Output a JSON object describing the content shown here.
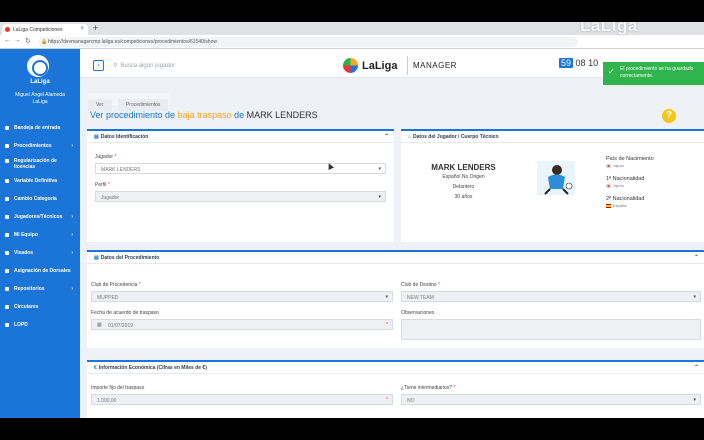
{
  "browser": {
    "tab_title": "LaLiga Competiciones",
    "url": "https://devmanagercmp.laliga.es/competiciones/procedimientos/61540/show",
    "watermark": "LaLiga"
  },
  "sidebar": {
    "brand": "LaLiga",
    "user_name": "Miguel Ángel Alameda",
    "user_org": "LaLiga",
    "items": [
      {
        "label": "Bandeja de entrada",
        "icon": "inbox-icon",
        "chevron": false
      },
      {
        "label": "Procedimientos",
        "icon": "list-icon",
        "chevron": true
      },
      {
        "label": "Regularización de licencias",
        "icon": "license-icon",
        "chevron": false
      },
      {
        "label": "Variable Definitiva",
        "icon": "variable-icon",
        "chevron": false
      },
      {
        "label": "Cambio Categoría",
        "icon": "swap-icon",
        "chevron": false
      },
      {
        "label": "Jugadores/Técnicos",
        "icon": "player-icon",
        "chevron": true
      },
      {
        "label": "Mi Equipo",
        "icon": "team-icon",
        "chevron": true
      },
      {
        "label": "Visados",
        "icon": "visa-icon",
        "chevron": true
      },
      {
        "label": "Asignación de Dorsales",
        "icon": "shirt-icon",
        "chevron": false
      },
      {
        "label": "Repositorios",
        "icon": "folder-icon",
        "chevron": true
      },
      {
        "label": "Circulares",
        "icon": "circular-icon",
        "chevron": false
      },
      {
        "label": "LOPD",
        "icon": "shield-icon",
        "chevron": false
      }
    ]
  },
  "header": {
    "search_placeholder": "Busca algún jugador",
    "logo_text": "LaLiga",
    "section": "MANAGER",
    "clock_a": "59",
    "clock_b": "08",
    "clock_c": "10"
  },
  "toast": {
    "message": "El procedimiento se ha guardado correctamente.",
    "color": "#2fb54b"
  },
  "breadcrumb": [
    "Ver",
    "Procedimientos"
  ],
  "page": {
    "title_prefix": "Ver procedimiento de ",
    "title_highlight": "baja traspaso",
    "title_mid": " de ",
    "title_name": "MARK LENDERS"
  },
  "identificacion": {
    "title": "Datos Identificación",
    "jugador_label": "Jugador",
    "jugador_value": "MARK LENDERS",
    "perfil_label": "Perfil",
    "perfil_value": "Jugador"
  },
  "jugador_card": {
    "title": "Datos del Jugador / Cuerpo Técnico",
    "name": "MARK LENDERS",
    "origin": "Español No Origen",
    "position": "Delantero",
    "age": "30 años",
    "pais_label": "País de Nacimiento",
    "pais_value": "Japón",
    "nac1_label": "1ª Nacionalidad",
    "nac1_value": "Japón",
    "nac2_label": "2ª Nacionalidad",
    "nac2_value": "España"
  },
  "procedimiento": {
    "title": "Datos del Procedimiento",
    "club_proc_label": "Club de Procedencia",
    "club_proc_value": "MUPPED",
    "club_dest_label": "Club de Destino",
    "club_dest_value": "NEW TEAM",
    "fecha_label": "Fecha de acuerdo de traspaso",
    "fecha_value": "01/07/2019",
    "obs_label": "Observaciones"
  },
  "economica": {
    "title": "Información Económica (Cifras en Miles de €)",
    "importe_label": "Importe fijo del traspaso",
    "importe_value": "1.000,00",
    "inter_label": "¿Tiene intermediarios?",
    "inter_value": "NO"
  },
  "colors": {
    "accent": "#1b74d8",
    "highlight": "#f5a623",
    "success": "#2fb54b"
  }
}
